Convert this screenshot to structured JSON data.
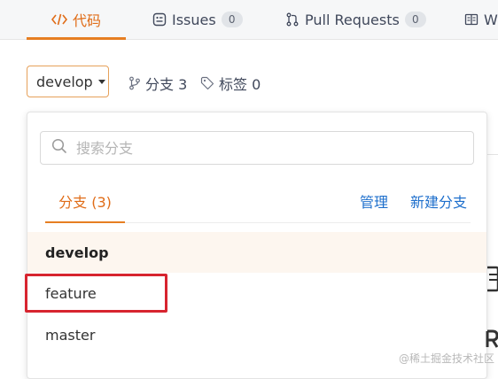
{
  "tabs": [
    {
      "label": "代码",
      "icon": "code-icon",
      "active": true
    },
    {
      "label": "Issues",
      "icon": "issues-icon",
      "badge": "0"
    },
    {
      "label": "Pull Requests",
      "icon": "pull-request-icon",
      "badge": "0"
    },
    {
      "label": "W",
      "icon": "wiki-icon"
    }
  ],
  "branch_selector": {
    "value": "develop"
  },
  "meta": {
    "branches": "分支 3",
    "tags": "标签 0"
  },
  "dropdown": {
    "search_placeholder": "搜索分支",
    "tab_branches": "分支 (3)",
    "manage": "管理",
    "new_branch": "新建分支",
    "items": [
      "develop",
      "feature",
      "master"
    ]
  },
  "watermark": "@稀土掘金技术社区",
  "colors": {
    "accent": "#e67e22",
    "link": "#1e6fcc",
    "highlight_box": "#d7242f"
  }
}
